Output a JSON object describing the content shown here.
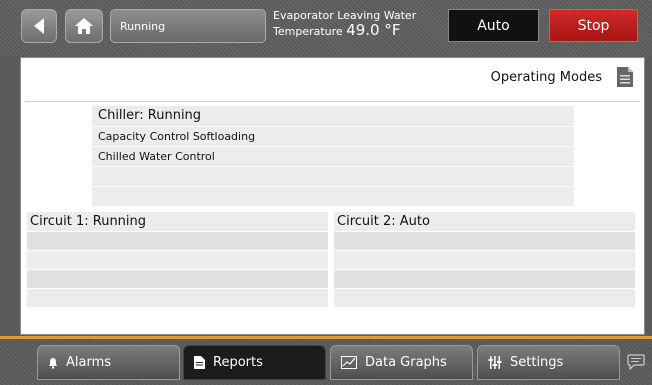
{
  "topbar": {
    "status_text": "Running",
    "evap_label": "Evaporator Leaving Water",
    "evap_temp_label": "Temperature",
    "evap_value": "49.0 °F",
    "auto_label": "Auto",
    "stop_label": "Stop"
  },
  "panel": {
    "operating_modes_label": "Operating Modes",
    "chiller": {
      "header": "Chiller:  Running",
      "items": [
        "Capacity Control Softloading",
        "Chilled Water Control",
        "",
        ""
      ]
    },
    "circuit1": {
      "header": "Circuit 1:  Running",
      "rows": [
        "",
        "",
        "",
        ""
      ]
    },
    "circuit2": {
      "header": "Circuit 2:  Auto",
      "rows": [
        "",
        "",
        "",
        ""
      ]
    }
  },
  "tabs": [
    {
      "label": "Alarms",
      "icon": "bell-icon"
    },
    {
      "label": "Reports",
      "icon": "document-icon"
    },
    {
      "label": "Data Graphs",
      "icon": "graph-icon"
    },
    {
      "label": "Settings",
      "icon": "sliders-icon"
    }
  ],
  "colors": {
    "stop": "#c01c1c",
    "accent": "#d9a028",
    "active_tab": "#1c1c1c"
  }
}
